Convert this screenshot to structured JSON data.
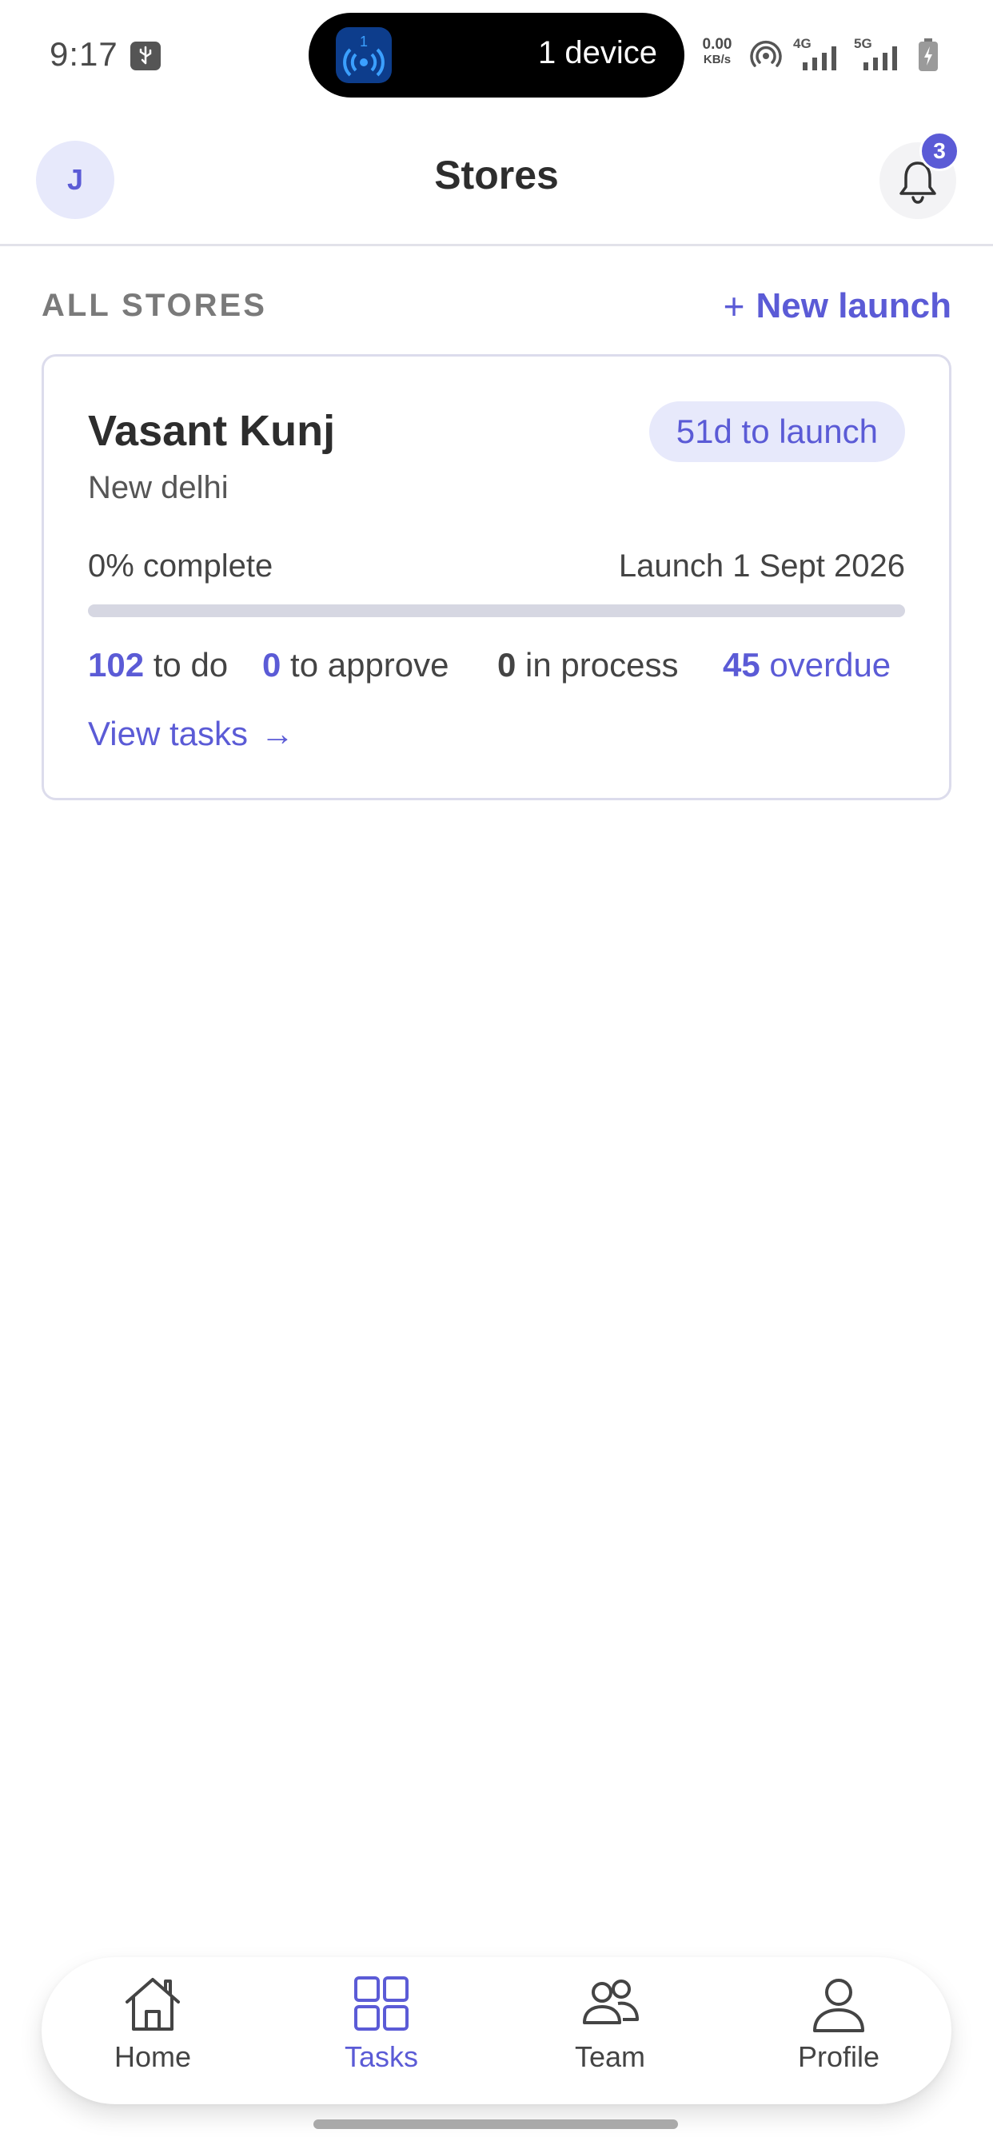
{
  "status_bar": {
    "time": "9:17",
    "island_badge": "1",
    "island_text": "1 device",
    "speed_value": "0.00",
    "speed_unit": "KB/s",
    "network_1": "4G",
    "network_2": "5G"
  },
  "header": {
    "avatar_initial": "J",
    "title": "Stores",
    "notification_count": "3"
  },
  "section": {
    "label": "ALL STORES",
    "new_launch_plus": "+",
    "new_launch_label": "New launch"
  },
  "stores": [
    {
      "name": "Vasant Kunj",
      "launch_badge": "51d to launch",
      "city": "New delhi",
      "percent_complete_label": "0% complete",
      "progress_fraction": 0,
      "launch_date_label": "Launch 1 Sept 2026",
      "todo_count": "102",
      "todo_label": "to do",
      "approve_count": "0",
      "approve_label": "to approve",
      "process_count": "0",
      "process_label": "in process",
      "overdue_count": "45",
      "overdue_label": "overdue",
      "view_tasks_label": "View tasks",
      "view_tasks_arrow": "→"
    }
  ],
  "bottom_nav": {
    "items": [
      {
        "label": "Home",
        "icon": "home-icon",
        "active": false
      },
      {
        "label": "Tasks",
        "icon": "grid-icon",
        "active": true
      },
      {
        "label": "Team",
        "icon": "team-icon",
        "active": false
      },
      {
        "label": "Profile",
        "icon": "profile-icon",
        "active": false
      }
    ]
  },
  "colors": {
    "accent": "#5b5bd6",
    "accent_soft": "#e7e9fb",
    "text": "#2d2d2d"
  }
}
